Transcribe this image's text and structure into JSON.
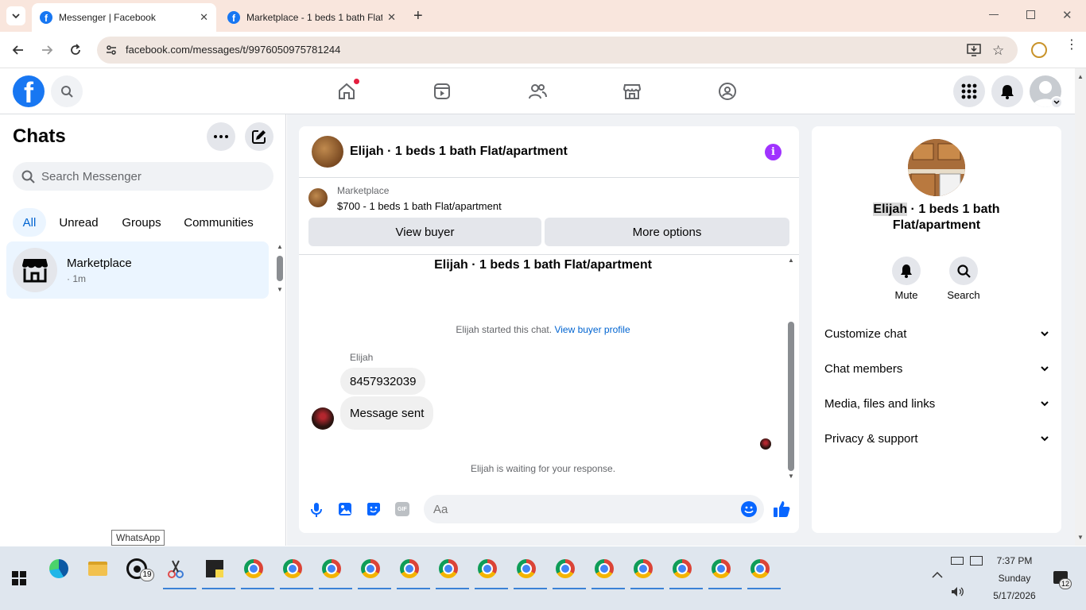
{
  "browser": {
    "tabs": [
      {
        "title": "Messenger | Facebook",
        "active": true
      },
      {
        "title": "Marketplace - 1 beds 1 bath Flat/apartment",
        "active": false
      }
    ],
    "url": "facebook.com/messages/t/9976050975781244"
  },
  "fb": {
    "logo": "f"
  },
  "sidebar": {
    "title": "Chats",
    "search_placeholder": "Search Messenger",
    "filters": [
      "All",
      "Unread",
      "Groups",
      "Communities"
    ],
    "chat_item": {
      "name": "Marketplace",
      "time": "· 1m"
    }
  },
  "conversation": {
    "header_title": "Elijah · 1 beds 1 bath Flat/apartment",
    "listing": {
      "source": "Marketplace",
      "title": "$700 - 1 beds 1 bath Flat/apartment"
    },
    "buttons": {
      "view_buyer": "View buyer",
      "more_options": "More options"
    },
    "thread_title": "Elijah · 1 beds 1 bath Flat/apartment",
    "system_message": "Elijah started this chat.",
    "system_link": "View buyer profile",
    "sender_name": "Elijah",
    "messages": [
      "8457932039",
      "Message sent"
    ],
    "waiting_text": "Elijah is waiting for your response.",
    "composer_placeholder": "Aa"
  },
  "info_panel": {
    "name_highlight": "Elijah",
    "name_rest": " · 1 beds 1 bath",
    "name_line2": "Flat/apartment",
    "actions": [
      {
        "label": "Mute"
      },
      {
        "label": "Search"
      }
    ],
    "sections": [
      "Customize chat",
      "Chat members",
      "Media, files and links",
      "Privacy & support"
    ]
  },
  "taskbar": {
    "tooltip": "WhatsApp",
    "whatsapp_badge": "19",
    "time": "7:37 PM",
    "day": "Sunday",
    "date": "5/17/2026",
    "notifications": "12"
  },
  "colors": {
    "fb_blue": "#1877f2",
    "purple": "#a033ff",
    "messenger_blue": "#0064d1"
  }
}
